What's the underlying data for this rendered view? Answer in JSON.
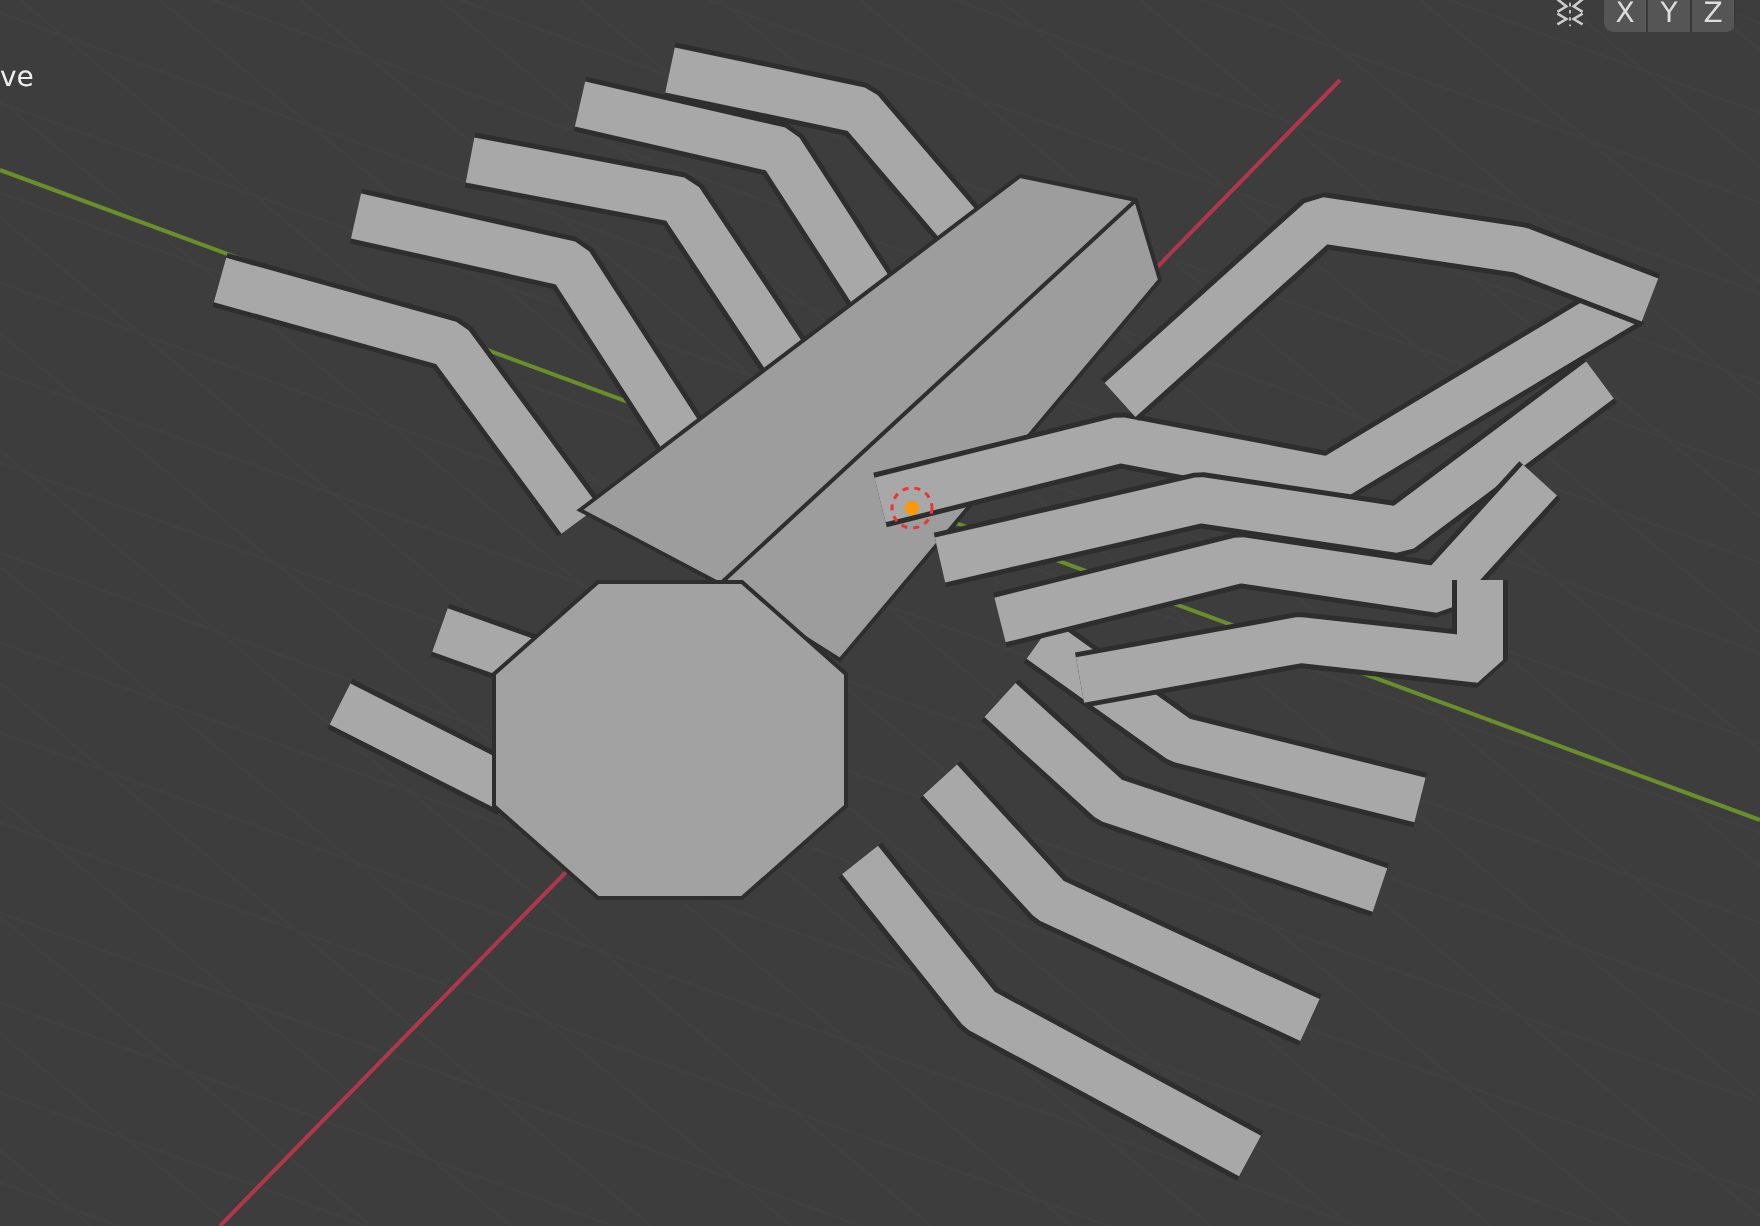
{
  "viewport": {
    "mode_label": "ve"
  },
  "axis_buttons": [
    {
      "label": "X"
    },
    {
      "label": "Y"
    },
    {
      "label": "Z"
    }
  ]
}
